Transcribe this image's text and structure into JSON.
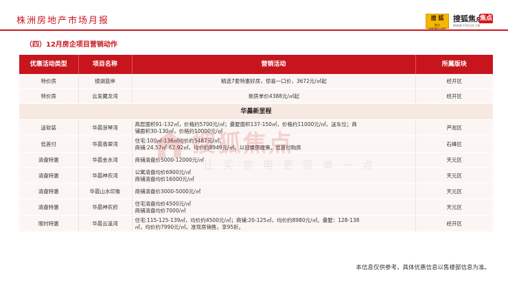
{
  "header": {
    "title": "株洲房地产市场月报",
    "logo_left_main": "搜 狐",
    "logo_left_sub": "焦点jiaodian.com",
    "logo_right_main": "搜狐焦点",
    "logo_right_house": "焦点",
    "logo_right_sub": "WWW.FOCUS.CN"
  },
  "section_title": "（四）12月房企项目营销动作",
  "table": {
    "columns": [
      "优惠活动类型",
      "项目名称",
      "营销活动",
      "所属版块"
    ],
    "rows_before_group": [
      {
        "type": "特价房",
        "project": "镜湖蓝岸",
        "activity": [
          "精选7套特惠好房，惊喜一口价，3672元/㎡起"
        ],
        "district": "经开区"
      },
      {
        "type": "特价房",
        "project": "云发藏龙湾",
        "activity": [
          "新房单价4388元/㎡起"
        ],
        "district": "经开区"
      }
    ],
    "group_title": "华晨新里程",
    "rows_after_group": [
      {
        "type": "送软装",
        "project": "华晨浪琴湾",
        "activity": [
          "高层面积91-132㎡，价格约5700元/㎡；叠墅面积137-150㎡，价格约11000元/㎡，送车位；商",
          "铺面积30-130㎡，价格约10000元/㎡"
        ],
        "district": "芦淞区"
      },
      {
        "type": "低首付",
        "project": "华晨翡翠湾",
        "activity": [
          "住宅:100㎡-136㎡均价约5487元/㎡。",
          "商铺:24.57㎡-62.92㎡，均价约8949元/㎡。以旧换房政策、低首付购房"
        ],
        "district": "石峰区"
      },
      {
        "type": "清盘特惠",
        "project": "华晨金水湾",
        "activity": [
          "商铺清盘价5000-12000元/㎡"
        ],
        "district": "天元区"
      },
      {
        "type": "清盘特惠",
        "project": "华晨神农湾",
        "activity": [
          "公寓清盘均价6900元/㎡",
          "商铺清盘均价16000元/㎡"
        ],
        "district": "天元区"
      },
      {
        "type": "清盘特惠",
        "project": "华晨山水印象",
        "activity": [
          "商铺清盘价3000-5000元/㎡"
        ],
        "district": "天元区"
      },
      {
        "type": "清盘特惠",
        "project": "华晨神农府",
        "activity": [
          "住宅清盘均价4500元/㎡",
          "商铺清盘均价7000/㎡"
        ],
        "district": "天元区"
      },
      {
        "type": "限时特惠",
        "project": "华晨云溪湾",
        "activity": [
          "住宅:115-125-139㎡，均价约4500元/㎡；商铺:20-125㎡，均价约8980元/㎡。叠墅：128-138",
          "㎡，均价约7990元/㎡。准现房销售，享95折。"
        ],
        "district": "经开区"
      }
    ]
  },
  "watermark": {
    "main": "搜狐焦点",
    "sub": "让买房用更简单一点"
  },
  "footnote": "本信息仅供参考，具体优惠信息以售楼部信息为准。",
  "colors": {
    "brand_red": "#c8151d",
    "row_bg": "#fbf6f3",
    "group_bg": "#f7e9e1",
    "logo_gold": "#f4b800"
  }
}
